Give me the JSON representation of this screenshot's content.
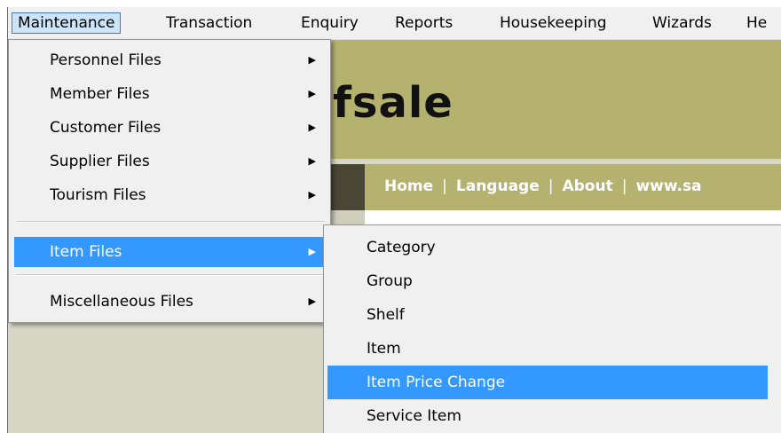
{
  "menubar": {
    "items": [
      "Maintenance",
      "Transaction",
      "Enquiry",
      "Reports",
      "Housekeeping",
      "Wizards",
      "He"
    ]
  },
  "app": {
    "brand": "fsale",
    "nav": {
      "links": [
        "Home",
        "Language",
        "About",
        "www.sa"
      ],
      "separator": "|"
    }
  },
  "maintenance_menu": {
    "items": [
      {
        "label": "Personnel Files",
        "has_submenu": true
      },
      {
        "label": "Member Files",
        "has_submenu": true
      },
      {
        "label": "Customer Files",
        "has_submenu": true
      },
      {
        "label": "Supplier Files",
        "has_submenu": true
      },
      {
        "label": "Tourism Files",
        "has_submenu": true
      },
      {
        "label": "Item Files",
        "has_submenu": true,
        "highlighted": true
      },
      {
        "label": "Miscellaneous Files",
        "has_submenu": true
      }
    ],
    "arrow_icon": "▶"
  },
  "item_files_submenu": {
    "items": [
      {
        "label": "Category"
      },
      {
        "label": "Group"
      },
      {
        "label": "Shelf"
      },
      {
        "label": "Item"
      },
      {
        "label": "Item Price Change",
        "highlighted": true
      },
      {
        "label": "Service Item"
      }
    ]
  },
  "colors": {
    "highlight": "#3399ff",
    "menubar_active": "#cce4f7",
    "banner": "#b5b270",
    "nav_dark": "#4a4636",
    "background": "#d8d6c5"
  }
}
